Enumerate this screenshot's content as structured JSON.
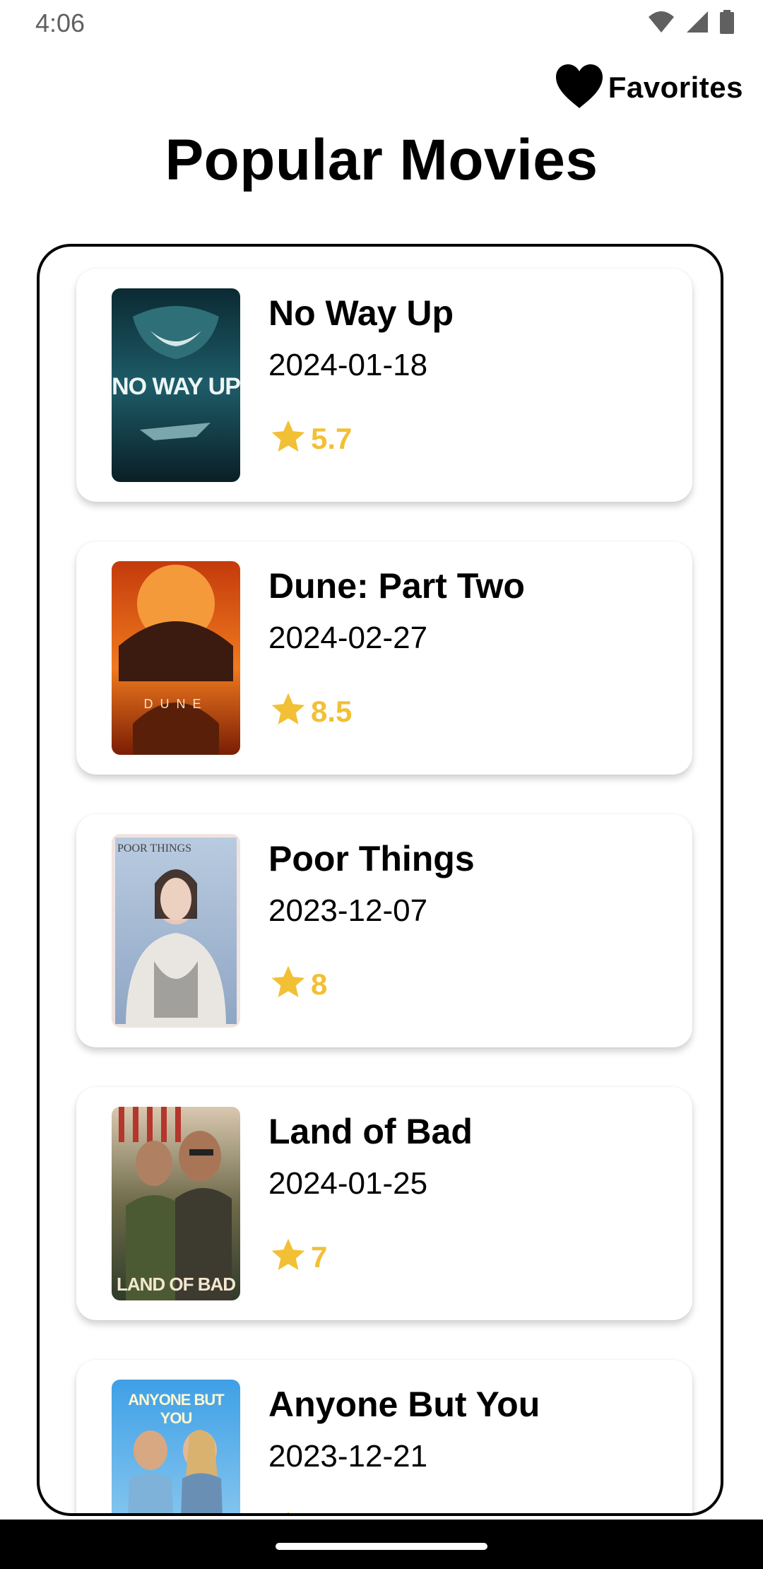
{
  "status_bar": {
    "time": "4:06",
    "icons": [
      "wifi-icon",
      "cellular-signal-icon",
      "battery-icon"
    ]
  },
  "header": {
    "favorites_label": "Favorites",
    "favorites_icon": "heart-icon",
    "title": "Popular Movies"
  },
  "colors": {
    "rating": "#f2c035",
    "text": "#000000",
    "background": "#ffffff"
  },
  "movies": [
    {
      "title": "No Way Up",
      "release_date": "2024-01-18",
      "rating": "5.7",
      "poster_text": "NO WAY UP"
    },
    {
      "title": "Dune: Part Two",
      "release_date": "2024-02-27",
      "rating": "8.5",
      "poster_text": "DUNE"
    },
    {
      "title": "Poor Things",
      "release_date": "2023-12-07",
      "rating": "8",
      "poster_text": "POOR THINGS"
    },
    {
      "title": "Land of Bad",
      "release_date": "2024-01-25",
      "rating": "7",
      "poster_text": "LAND OF BAD"
    },
    {
      "title": "Anyone But You",
      "release_date": "2023-12-21",
      "rating": "",
      "poster_text": "ANYONE BUT YOU"
    }
  ]
}
